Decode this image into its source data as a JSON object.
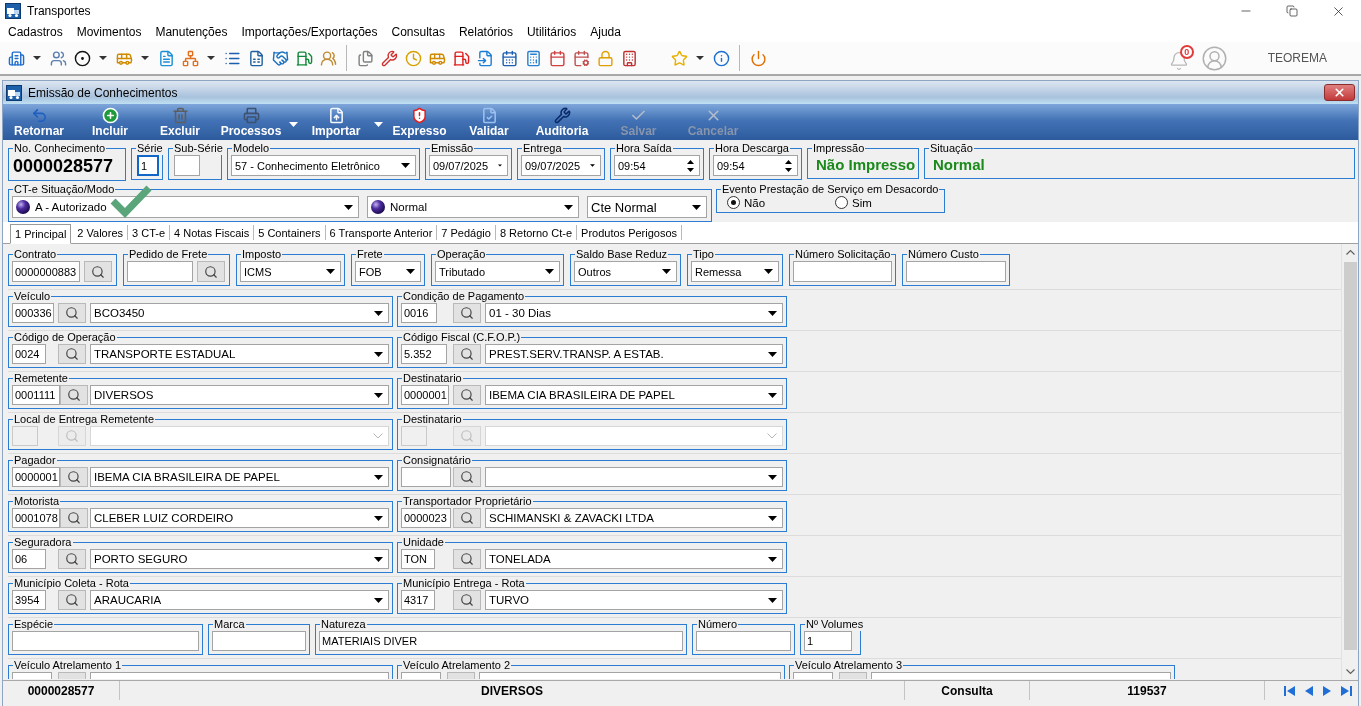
{
  "app": {
    "title": "Transportes"
  },
  "menu": [
    "Cadastros",
    "Movimentos",
    "Manutenções",
    "Importações/Exportações",
    "Consultas",
    "Relatórios",
    "Utilitários",
    "Ajuda"
  ],
  "user_area": {
    "notifications": "0",
    "user": "TEOREMA"
  },
  "window": {
    "title": "Emissão de Conhecimentos"
  },
  "toolbar": [
    {
      "label": "Retornar",
      "disabled": false,
      "dropdown": false
    },
    {
      "label": "Incluir",
      "disabled": false,
      "dropdown": false
    },
    {
      "label": "Excluir",
      "disabled": false,
      "dropdown": false
    },
    {
      "label": "Processos",
      "disabled": false,
      "dropdown": true
    },
    {
      "label": "Importar",
      "disabled": false,
      "dropdown": true
    },
    {
      "label": "Expresso",
      "disabled": false,
      "dropdown": false
    },
    {
      "label": "Validar",
      "disabled": false,
      "dropdown": false
    },
    {
      "label": "Auditoria",
      "disabled": false,
      "dropdown": false
    },
    {
      "label": "Salvar",
      "disabled": true,
      "dropdown": false
    },
    {
      "label": "Cancelar",
      "disabled": true,
      "dropdown": false
    }
  ],
  "header_fields": [
    {
      "kind": "number",
      "label": "No. Conhecimento",
      "value": "0000028577"
    },
    {
      "kind": "input",
      "label": "Série",
      "value": "1",
      "focused": true
    },
    {
      "kind": "input",
      "label": "Sub-Série",
      "focused": false
    },
    {
      "kind": "select",
      "label": "Modelo",
      "value": "57 - Conhecimento Eletrônico"
    },
    {
      "kind": "date",
      "label": "Emissão",
      "value": "09/07/2025"
    },
    {
      "kind": "date",
      "label": "Entrega",
      "value": "09/07/2025"
    },
    {
      "kind": "time",
      "label": "Hora Saída",
      "value": "09:54"
    },
    {
      "kind": "time",
      "label": "Hora Descarga",
      "value": "09:54"
    },
    {
      "kind": "status",
      "label": "Impressão",
      "value": "Não Impresso"
    },
    {
      "kind": "status",
      "label": "Situação",
      "value": "Normal"
    }
  ],
  "cte_mode": {
    "label": "CT-e Situação/Modo",
    "situation": "A - Autorizado",
    "mode": "Normal",
    "type": "Cte Normal"
  },
  "desacordo": {
    "label": "Evento Prestação de Serviço em Desacordo",
    "options": [
      {
        "label": "Não",
        "selected": true
      },
      {
        "label": "Sim",
        "selected": false
      }
    ]
  },
  "tabs": [
    {
      "label": "1 Principal",
      "selected": true
    },
    {
      "label": "2 Valores",
      "selected": false
    },
    {
      "label": "3 CT-e",
      "selected": false
    },
    {
      "label": "4 Notas Fiscais",
      "selected": false
    },
    {
      "label": "5 Containers",
      "selected": false
    },
    {
      "label": "6 Transporte Anterior",
      "selected": false
    },
    {
      "label": "7 Pedágio",
      "selected": false
    },
    {
      "label": "8 Retorno Ct-e",
      "selected": false
    },
    {
      "label": "Produtos Perigosos",
      "selected": false
    }
  ],
  "principal_fields": [
    {
      "kind": "lookup",
      "label": "Contrato",
      "value": "0000000883"
    },
    {
      "kind": "lookup",
      "label": "Pedido de Frete"
    },
    {
      "kind": "select",
      "label": "Imposto",
      "value": "ICMS"
    },
    {
      "kind": "select",
      "label": "Frete",
      "value": "FOB"
    },
    {
      "kind": "select",
      "label": "Operação",
      "value": "Tributado"
    },
    {
      "kind": "select",
      "label": "Saldo Base Reduz",
      "value": "Outros"
    },
    {
      "kind": "select",
      "label": "Tipo",
      "value": "Remessa"
    },
    {
      "kind": "input",
      "label": "Número Solicitação"
    },
    {
      "kind": "input",
      "label": "Número Custo"
    }
  ],
  "lookup_rows": [
    {
      "left": {
        "label": "Veículo",
        "code": "000336",
        "value": "BCO3450",
        "disabled": false
      },
      "right": {
        "label": "Condição de Pagamento",
        "code": "0016",
        "value": "01 - 30 Dias",
        "disabled": false
      }
    },
    {
      "left": {
        "label": "Código de Operação",
        "code": "0024",
        "value": "TRANSPORTE ESTADUAL",
        "disabled": false
      },
      "right": {
        "label": "Código Fiscal (C.F.O.P.)",
        "code": "5.352",
        "value": "PREST.SERV.TRANSP. A ESTAB.",
        "disabled": false
      }
    },
    {
      "left": {
        "label": "Remetente",
        "code": "0001111",
        "value": "DIVERSOS",
        "disabled": false
      },
      "right": {
        "label": "Destinatario",
        "code": "0000001",
        "value": "IBEMA CIA BRASILEIRA DE PAPEL",
        "disabled": false
      }
    },
    {
      "left": {
        "label": "Local de Entrega Remetente",
        "disabled": true
      },
      "right": {
        "label": "Destinatario",
        "disabled": true
      }
    },
    {
      "left": {
        "label": "Pagador",
        "code": "0000001",
        "value": "IBEMA CIA BRASILEIRA DE PAPEL",
        "disabled": false
      },
      "right": {
        "label": "Consignatário",
        "disabled": false
      }
    },
    {
      "left": {
        "label": "Motorista",
        "code": "0001078",
        "value": "CLEBER LUIZ CORDEIRO",
        "disabled": false
      },
      "right": {
        "label": "Transportador Proprietário",
        "code": "0000023",
        "value": "SCHIMANSKI & ZAVACKI LTDA",
        "disabled": false
      }
    },
    {
      "left": {
        "label": "Seguradora",
        "code": "06",
        "value": "PORTO SEGURO",
        "disabled": false
      },
      "right": {
        "label": "Unidade",
        "code": "TON",
        "value": "TONELADA",
        "disabled": false
      }
    },
    {
      "left": {
        "label": "Município Coleta - Rota",
        "code": "3954",
        "value": "ARAUCARIA",
        "disabled": false
      },
      "right": {
        "label": "Município Entrega - Rota",
        "code": "4317",
        "value": "TURVO",
        "disabled": false
      }
    }
  ],
  "cargo_fields": [
    {
      "label": "Espécie"
    },
    {
      "label": "Marca"
    },
    {
      "label": "Natureza",
      "value": "MATERIAIS DIVER"
    },
    {
      "label": "Número"
    },
    {
      "label": "Nº Volumes",
      "value": "1"
    }
  ],
  "trailer_fields": [
    {
      "label": "Veículo Atrelamento 1"
    },
    {
      "label": "Veículo Atrelamento 2"
    },
    {
      "label": "Veículo Atrelamento 3"
    }
  ],
  "status_bar": [
    "0000028577",
    "DIVERSOS",
    "Consulta",
    "119537"
  ]
}
